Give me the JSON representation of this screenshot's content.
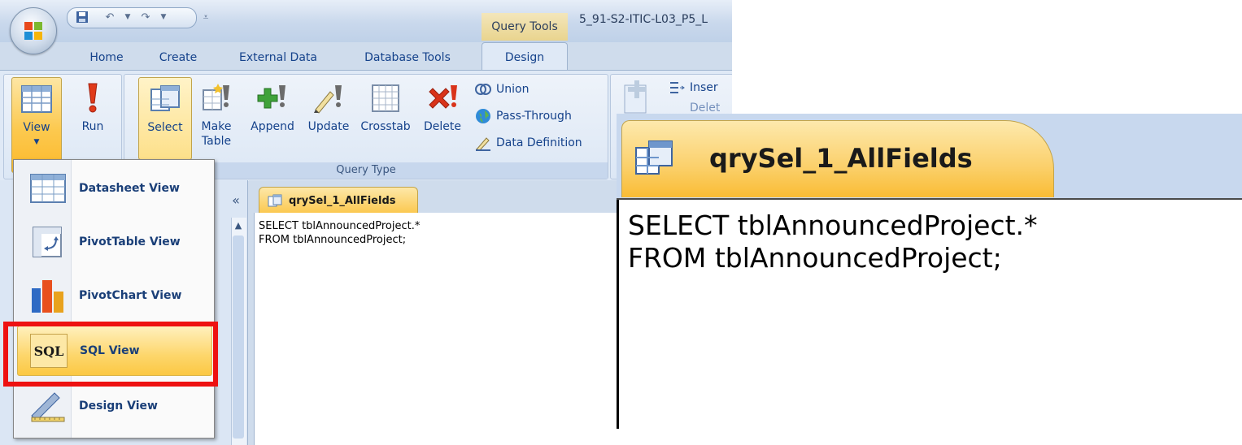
{
  "app": {
    "context_tab": "Query Tools",
    "window_title": "5_91-S2-ITIC-L03_P5_L"
  },
  "tabs": [
    "Home",
    "Create",
    "External Data",
    "Database Tools",
    "Design"
  ],
  "ribbon": {
    "buttons": {
      "view": "View",
      "run": "Run",
      "select": "Select",
      "make_table_1": "Make",
      "make_table_2": "Table",
      "append": "Append",
      "update": "Update",
      "crosstab": "Crosstab",
      "delete": "Delete"
    },
    "small": {
      "union": "Union",
      "pass_through": "Pass-Through",
      "data_definition": "Data Definition",
      "insert": "Inser",
      "delete_cut": "Delet"
    },
    "group_label": "Query Type"
  },
  "menu": {
    "items": [
      {
        "label": "Datasheet View",
        "icon": "datasheet-icon"
      },
      {
        "label": "PivotTable View",
        "icon": "pivottable-icon"
      },
      {
        "label": "PivotChart View",
        "icon": "pivotchart-icon"
      },
      {
        "label": "SQL View",
        "icon": "sql-icon"
      },
      {
        "label": "Design View",
        "icon": "design-icon"
      }
    ],
    "sql_badge": "SQL",
    "selected": "SQL View"
  },
  "nav": {
    "collapse": "«"
  },
  "document": {
    "tab_label": "qrySel_1_AllFields",
    "sql": "SELECT tblAnnouncedProject.*\nFROM tblAnnouncedProject;"
  },
  "zoom": {
    "tab_label": "qrySel_1_AllFields",
    "sql": "SELECT tblAnnouncedProject.*\nFROM tblAnnouncedProject;"
  },
  "colors": {
    "ribbon": "#dfe9f6",
    "pressed": "#fbc84e",
    "highlight": "#ee1111",
    "tab_text": "#15428b"
  }
}
